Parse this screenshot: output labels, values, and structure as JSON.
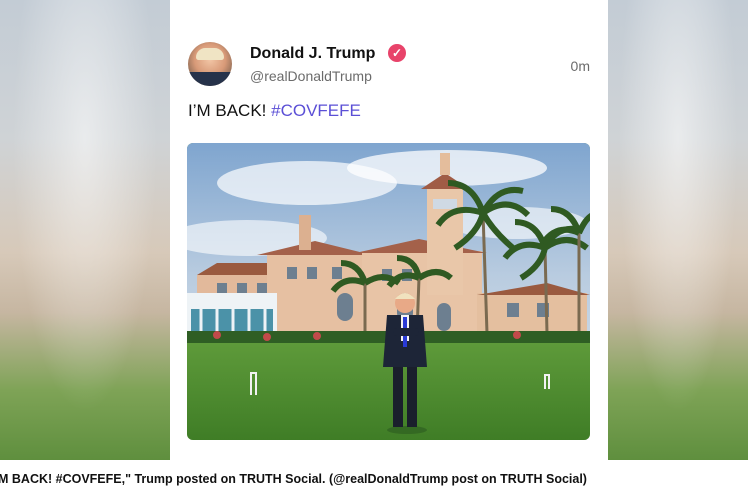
{
  "post": {
    "display_name": "Donald J. Trump",
    "verified_icon": "verified-badge-icon",
    "handle": "@realDonaldTrump",
    "timestamp": "0m",
    "text_main": "I’M BACK! ",
    "hashtag": "#COVFEFE"
  },
  "caption": {
    "text": "M BACK! #COVFEFE,\" Trump posted on TRUTH Social. (@realDonaldTrump post on TRUTH Social)"
  },
  "colors": {
    "hashtag": "#5b4fd6",
    "verified": "#e8436a",
    "card_background": "#ffffff"
  }
}
